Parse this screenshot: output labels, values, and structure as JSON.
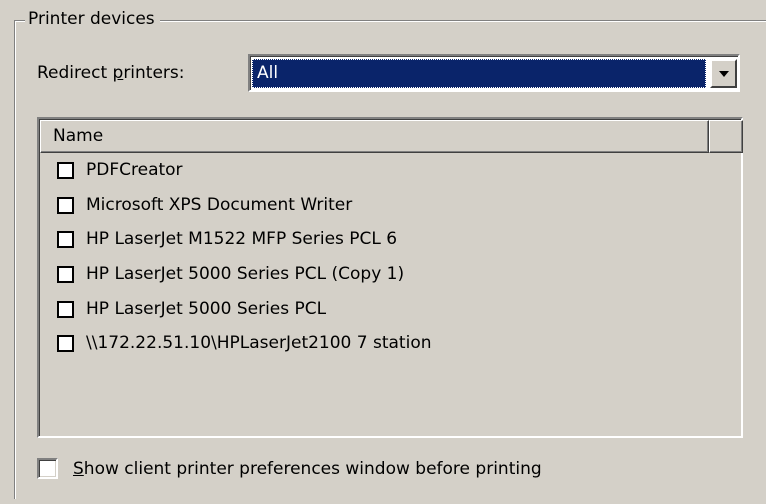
{
  "group": {
    "title": "Printer devices"
  },
  "redirect": {
    "label_prefix": "Redirect ",
    "label_mnemonic": "p",
    "label_suffix": "rinters:",
    "selected_value": "All"
  },
  "list": {
    "columns": [
      "Name",
      ""
    ],
    "items": [
      {
        "label": "PDFCreator",
        "checked": false
      },
      {
        "label": "Microsoft XPS Document Writer",
        "checked": false
      },
      {
        "label": "HP LaserJet M1522 MFP Series PCL 6",
        "checked": false
      },
      {
        "label": "HP LaserJet 5000 Series PCL (Copy 1)",
        "checked": false
      },
      {
        "label": "HP LaserJet 5000 Series PCL",
        "checked": false
      },
      {
        "label": "\\\\172.22.51.10\\HPLaserJet2100 7 station",
        "checked": false
      }
    ]
  },
  "option": {
    "mnemonic": "S",
    "label_rest": "how client printer preferences window before printing",
    "checked": false
  },
  "colors": {
    "face": "#d4d0c8",
    "selection": "#0a246a",
    "shadow": "#808080",
    "highlight": "#ffffff"
  },
  "icons": {
    "combo_button": "chevron-down-icon"
  }
}
